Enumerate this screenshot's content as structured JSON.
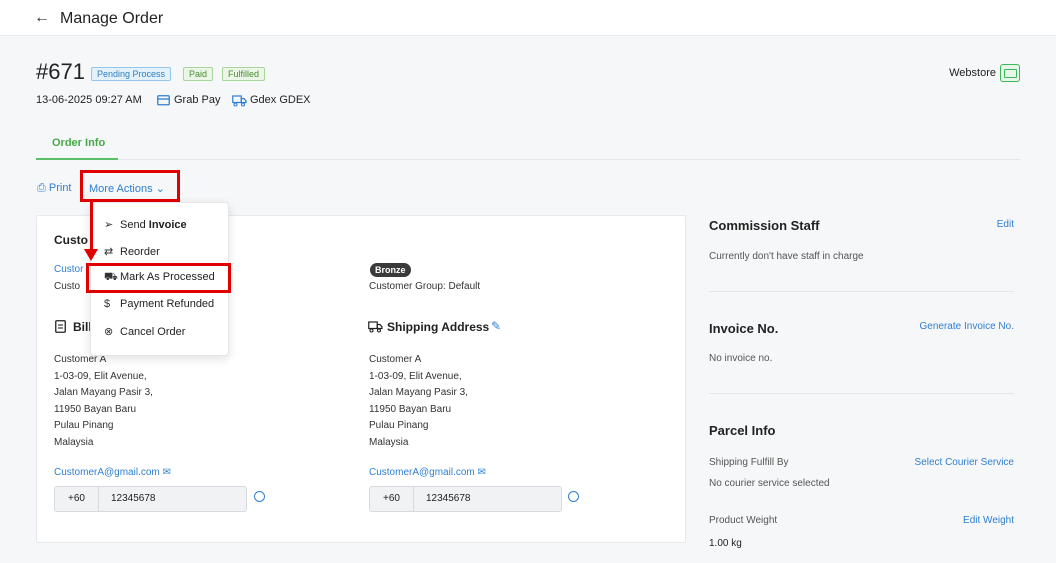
{
  "header": {
    "back_icon": "arrow-left-icon",
    "title": "Manage Order"
  },
  "order": {
    "number": "#671",
    "badges": {
      "pending": "Pending Process",
      "paid": "Paid",
      "fulfilled": "Fulfilled"
    },
    "datetime": "13-06-2025 09:27 AM",
    "payment": "Grab Pay",
    "courier": "Gdex GDEX",
    "channel": "Webstore"
  },
  "tabs": {
    "order_info": "Order Info"
  },
  "actions": {
    "print": "Print",
    "more": "More Actions"
  },
  "menu": {
    "send_prefix": "Send",
    "send_bold": "Invoice",
    "reorder": "Reorder",
    "mark_processed": "Mark As Processed",
    "payment_refunded": "Payment Refunded",
    "cancel_order": "Cancel Order"
  },
  "customer": {
    "title_visible": "Custo",
    "link_visible": "Custor",
    "line2_visible": "Custo",
    "tier": "Bronze",
    "group": "Customer Group: Default"
  },
  "billing": {
    "title_visible": "Bill",
    "lines": [
      "Customer A",
      "1-03-09, Elit Avenue,",
      "Jalan Mayang Pasir 3,",
      "11950 Bayan Baru",
      "Pulau Pinang",
      "Malaysia"
    ],
    "email": "CustomerA@gmail.com",
    "phone_code": "+60",
    "phone": "12345678"
  },
  "shipping": {
    "title": "Shipping Address",
    "lines": [
      "Customer A",
      "1-03-09, Elit Avenue,",
      "Jalan Mayang Pasir 3,",
      "11950 Bayan Baru",
      "Pulau Pinang",
      "Malaysia"
    ],
    "email": "CustomerA@gmail.com",
    "phone_code": "+60",
    "phone": "12345678"
  },
  "commission": {
    "title": "Commission Staff",
    "edit": "Edit",
    "text": "Currently don't have staff in charge"
  },
  "invoice": {
    "title": "Invoice No.",
    "generate": "Generate Invoice No.",
    "text": "No invoice no."
  },
  "parcel": {
    "title": "Parcel Info",
    "fulfill_label": "Shipping Fulfill By",
    "select_courier": "Select Courier Service",
    "no_courier": "No courier service selected",
    "weight_label": "Product Weight",
    "edit_weight": "Edit Weight",
    "weight": "1.00 kg"
  },
  "colors": {
    "accent_blue": "#2f7fd1",
    "accent_green": "#45a845",
    "highlight_red": "#e00000"
  }
}
